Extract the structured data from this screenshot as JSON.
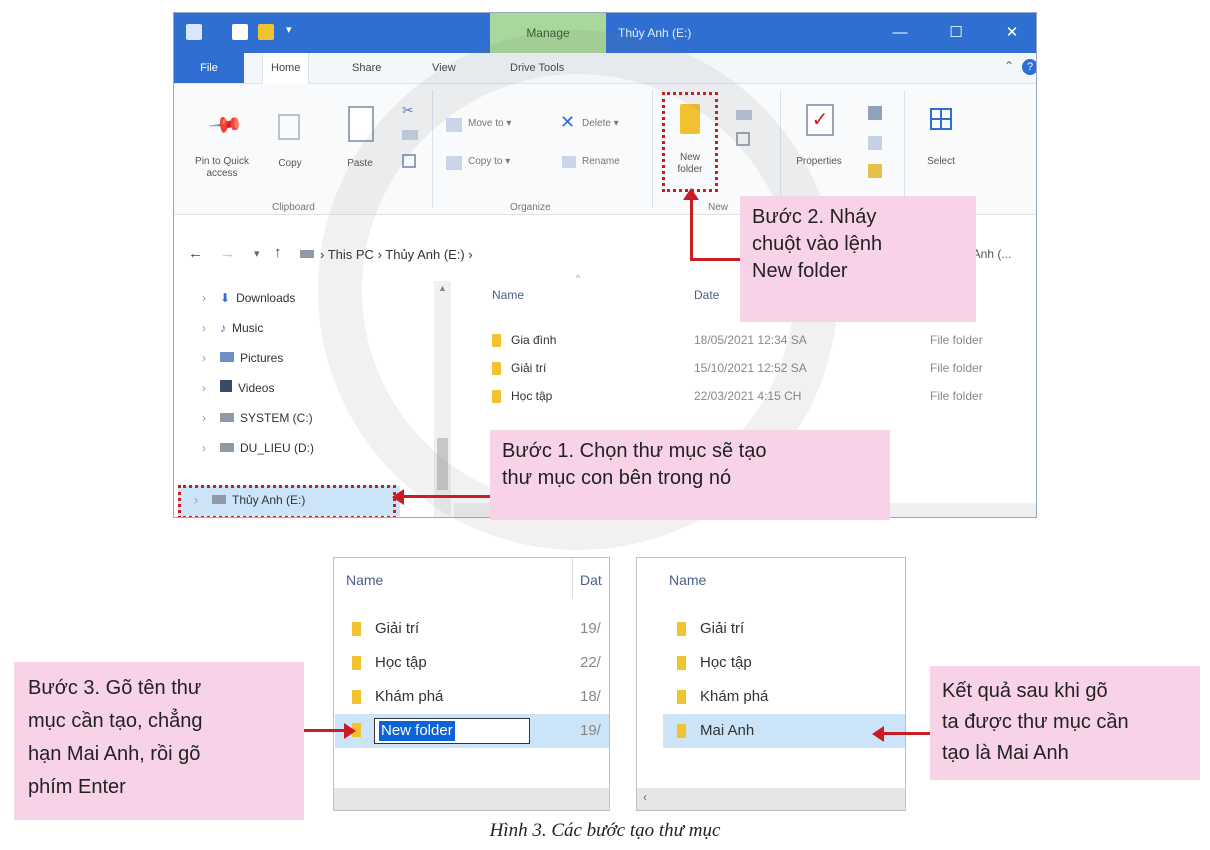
{
  "window": {
    "title": "Thủy Anh (E:)",
    "context_tab": "Manage",
    "controls": {
      "minimize": "—",
      "maximize": "☐",
      "close": "✕"
    }
  },
  "ribbon_tabs": [
    {
      "label": "File"
    },
    {
      "label": "Home"
    },
    {
      "label": "Share"
    },
    {
      "label": "View"
    },
    {
      "label": "Drive Tools"
    }
  ],
  "ribbon": {
    "clipboard": {
      "pin_label": "Pin to Quick access",
      "copy_label": "Copy",
      "paste_label": "Paste",
      "group": "Clipboard"
    },
    "organize": {
      "move_to": "Move to ▾",
      "copy_to": "Copy to ▾",
      "delete": "Delete ▾",
      "rename": "Rename",
      "group": "Organize"
    },
    "new": {
      "new_folder": "New folder",
      "group": "New"
    },
    "open": {
      "properties": "Properties"
    },
    "select": {
      "label": "Select"
    }
  },
  "address": {
    "path": [
      "This PC",
      "Thủy Anh (E:)"
    ],
    "search_placeholder": "y Anh (..."
  },
  "nav_items": [
    {
      "label": "Downloads",
      "icon": "download-icon"
    },
    {
      "label": "Music",
      "icon": "music-icon"
    },
    {
      "label": "Pictures",
      "icon": "pictures-icon"
    },
    {
      "label": "Videos",
      "icon": "videos-icon"
    },
    {
      "label": "SYSTEM (C:)",
      "icon": "drive-icon"
    },
    {
      "label": "DU_LIEU (D:)",
      "icon": "drive-icon"
    },
    {
      "label": "Thủy Anh (E:)",
      "icon": "drive-icon"
    }
  ],
  "columns": {
    "name": "Name",
    "date": "Date",
    "type": ""
  },
  "files": [
    {
      "name": "Gia đình",
      "date": "18/05/2021 12:34 SA",
      "type": "File folder"
    },
    {
      "name": "Giải trí",
      "date": "15/10/2021 12:52 SA",
      "type": "File folder"
    },
    {
      "name": "Học tập",
      "date": "22/03/2021 4:15 CH",
      "type": "File folder"
    }
  ],
  "callouts": {
    "step1": [
      "Bước 1. Chọn thư mục sẽ tạo",
      "thư mục con bên trong nó"
    ],
    "step2": [
      "Bước 2. Nháy",
      "chuột vào lệnh",
      "New folder"
    ],
    "step3": [
      "Bước 3. Gõ tên thư",
      "mục cần tạo, chẳng",
      "hạn Mai Anh, rồi gõ",
      "phím Enter"
    ],
    "result": [
      "Kết quả sau khi gõ",
      "ta được thư mục cần",
      "tạo là Mai Anh"
    ]
  },
  "panel_left": {
    "header_name": "Name",
    "header_date": "Dat",
    "rows": [
      {
        "name": "Giải trí",
        "date": "19/"
      },
      {
        "name": "Học tập",
        "date": "22/"
      },
      {
        "name": "Khám phá",
        "date": "18/"
      }
    ],
    "edit_value": "New folder",
    "edit_date": "19/"
  },
  "panel_right": {
    "header_name": "Name",
    "rows": [
      {
        "name": "Giải trí"
      },
      {
        "name": "Học tập"
      },
      {
        "name": "Khám phá"
      },
      {
        "name": "Mai Anh"
      }
    ]
  },
  "caption": "Hình 3. Các bước tạo thư mục",
  "colors": {
    "titlebar": "#2f6fd1",
    "manage": "#a8d89a",
    "callout": "#f8d3e8",
    "arrow": "#c81d25",
    "selection": "#cce4f7"
  }
}
